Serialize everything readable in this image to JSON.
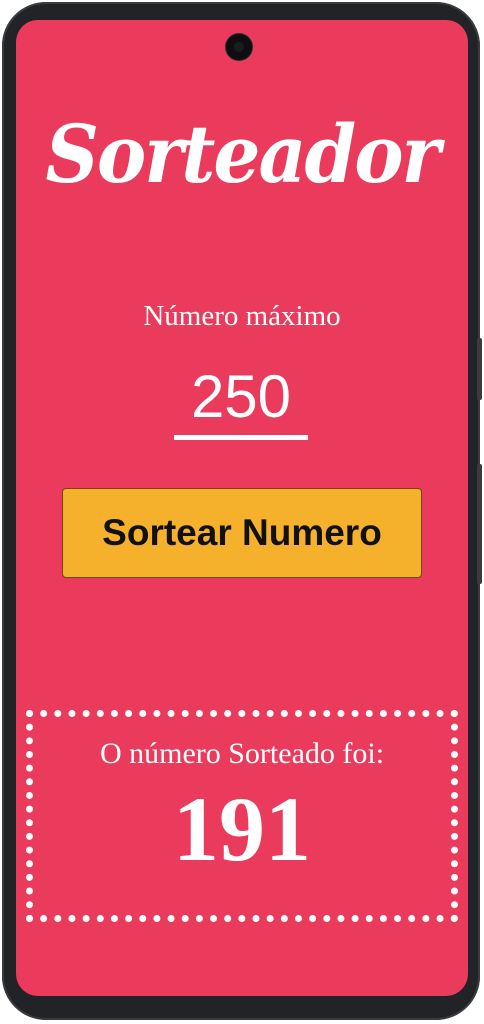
{
  "app": {
    "title": "Sorteador"
  },
  "max_number": {
    "label": "Número máximo",
    "value": "250"
  },
  "actions": {
    "draw_label": "Sortear Numero"
  },
  "result": {
    "label": "O número Sorteado foi:",
    "value": "191"
  },
  "theme": {
    "background": "#ea3b5c",
    "button": "#f6b12c",
    "text": "#ffffff"
  }
}
